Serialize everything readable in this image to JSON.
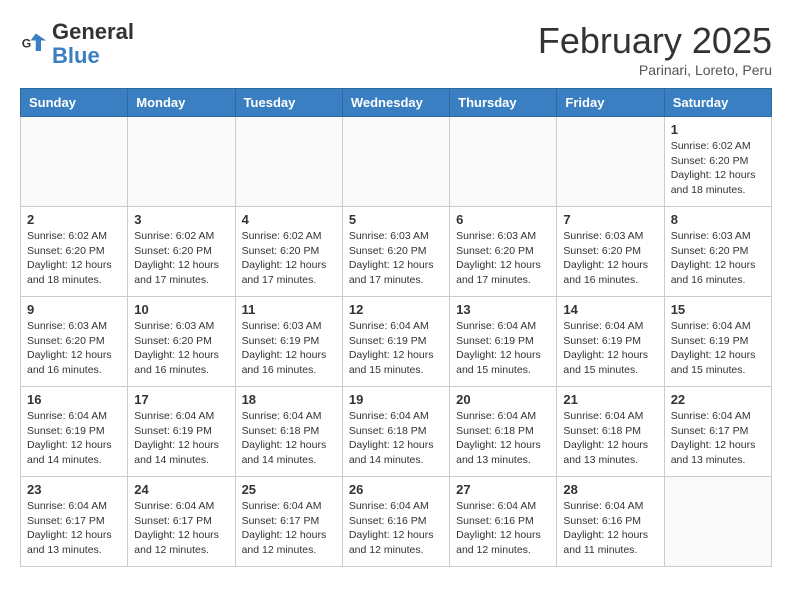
{
  "logo": {
    "general": "General",
    "blue": "Blue"
  },
  "header": {
    "month": "February 2025",
    "location": "Parinari, Loreto, Peru"
  },
  "weekdays": [
    "Sunday",
    "Monday",
    "Tuesday",
    "Wednesday",
    "Thursday",
    "Friday",
    "Saturday"
  ],
  "weeks": [
    [
      {
        "day": "",
        "info": ""
      },
      {
        "day": "",
        "info": ""
      },
      {
        "day": "",
        "info": ""
      },
      {
        "day": "",
        "info": ""
      },
      {
        "day": "",
        "info": ""
      },
      {
        "day": "",
        "info": ""
      },
      {
        "day": "1",
        "info": "Sunrise: 6:02 AM\nSunset: 6:20 PM\nDaylight: 12 hours\nand 18 minutes."
      }
    ],
    [
      {
        "day": "2",
        "info": "Sunrise: 6:02 AM\nSunset: 6:20 PM\nDaylight: 12 hours\nand 18 minutes."
      },
      {
        "day": "3",
        "info": "Sunrise: 6:02 AM\nSunset: 6:20 PM\nDaylight: 12 hours\nand 17 minutes."
      },
      {
        "day": "4",
        "info": "Sunrise: 6:02 AM\nSunset: 6:20 PM\nDaylight: 12 hours\nand 17 minutes."
      },
      {
        "day": "5",
        "info": "Sunrise: 6:03 AM\nSunset: 6:20 PM\nDaylight: 12 hours\nand 17 minutes."
      },
      {
        "day": "6",
        "info": "Sunrise: 6:03 AM\nSunset: 6:20 PM\nDaylight: 12 hours\nand 17 minutes."
      },
      {
        "day": "7",
        "info": "Sunrise: 6:03 AM\nSunset: 6:20 PM\nDaylight: 12 hours\nand 16 minutes."
      },
      {
        "day": "8",
        "info": "Sunrise: 6:03 AM\nSunset: 6:20 PM\nDaylight: 12 hours\nand 16 minutes."
      }
    ],
    [
      {
        "day": "9",
        "info": "Sunrise: 6:03 AM\nSunset: 6:20 PM\nDaylight: 12 hours\nand 16 minutes."
      },
      {
        "day": "10",
        "info": "Sunrise: 6:03 AM\nSunset: 6:20 PM\nDaylight: 12 hours\nand 16 minutes."
      },
      {
        "day": "11",
        "info": "Sunrise: 6:03 AM\nSunset: 6:19 PM\nDaylight: 12 hours\nand 16 minutes."
      },
      {
        "day": "12",
        "info": "Sunrise: 6:04 AM\nSunset: 6:19 PM\nDaylight: 12 hours\nand 15 minutes."
      },
      {
        "day": "13",
        "info": "Sunrise: 6:04 AM\nSunset: 6:19 PM\nDaylight: 12 hours\nand 15 minutes."
      },
      {
        "day": "14",
        "info": "Sunrise: 6:04 AM\nSunset: 6:19 PM\nDaylight: 12 hours\nand 15 minutes."
      },
      {
        "day": "15",
        "info": "Sunrise: 6:04 AM\nSunset: 6:19 PM\nDaylight: 12 hours\nand 15 minutes."
      }
    ],
    [
      {
        "day": "16",
        "info": "Sunrise: 6:04 AM\nSunset: 6:19 PM\nDaylight: 12 hours\nand 14 minutes."
      },
      {
        "day": "17",
        "info": "Sunrise: 6:04 AM\nSunset: 6:19 PM\nDaylight: 12 hours\nand 14 minutes."
      },
      {
        "day": "18",
        "info": "Sunrise: 6:04 AM\nSunset: 6:18 PM\nDaylight: 12 hours\nand 14 minutes."
      },
      {
        "day": "19",
        "info": "Sunrise: 6:04 AM\nSunset: 6:18 PM\nDaylight: 12 hours\nand 14 minutes."
      },
      {
        "day": "20",
        "info": "Sunrise: 6:04 AM\nSunset: 6:18 PM\nDaylight: 12 hours\nand 13 minutes."
      },
      {
        "day": "21",
        "info": "Sunrise: 6:04 AM\nSunset: 6:18 PM\nDaylight: 12 hours\nand 13 minutes."
      },
      {
        "day": "22",
        "info": "Sunrise: 6:04 AM\nSunset: 6:17 PM\nDaylight: 12 hours\nand 13 minutes."
      }
    ],
    [
      {
        "day": "23",
        "info": "Sunrise: 6:04 AM\nSunset: 6:17 PM\nDaylight: 12 hours\nand 13 minutes."
      },
      {
        "day": "24",
        "info": "Sunrise: 6:04 AM\nSunset: 6:17 PM\nDaylight: 12 hours\nand 12 minutes."
      },
      {
        "day": "25",
        "info": "Sunrise: 6:04 AM\nSunset: 6:17 PM\nDaylight: 12 hours\nand 12 minutes."
      },
      {
        "day": "26",
        "info": "Sunrise: 6:04 AM\nSunset: 6:16 PM\nDaylight: 12 hours\nand 12 minutes."
      },
      {
        "day": "27",
        "info": "Sunrise: 6:04 AM\nSunset: 6:16 PM\nDaylight: 12 hours\nand 12 minutes."
      },
      {
        "day": "28",
        "info": "Sunrise: 6:04 AM\nSunset: 6:16 PM\nDaylight: 12 hours\nand 11 minutes."
      },
      {
        "day": "",
        "info": ""
      }
    ]
  ]
}
